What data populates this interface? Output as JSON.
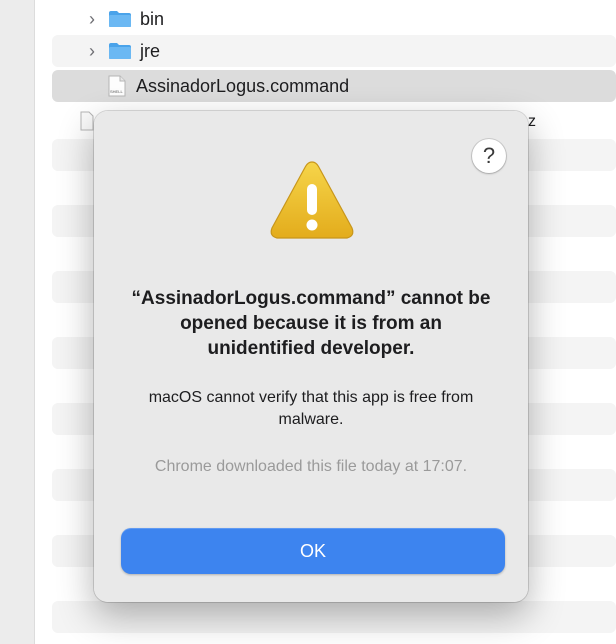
{
  "finder": {
    "rows": [
      {
        "label": "bin",
        "kind": "folder",
        "expanded": false
      },
      {
        "label": "jre",
        "kind": "folder",
        "expanded": false
      },
      {
        "label": "AssinadorLogus.command",
        "kind": "shell-script",
        "selected": true
      }
    ],
    "shell_icon_text": "SHELL",
    "partial_row_text": "z",
    "chevron_glyph": "›",
    "folder_color": "#5aaef0"
  },
  "dialog": {
    "help_glyph": "?",
    "title": "“AssinadorLogus.command” cannot be opened because it is from an unidentified developer.",
    "message": "macOS cannot verify that this app is free from malware.",
    "info": "Chrome downloaded this file today at 17:07.",
    "ok_label": "OK",
    "accent_color": "#3d84ef",
    "warning_icon": "warning-triangle-icon"
  }
}
